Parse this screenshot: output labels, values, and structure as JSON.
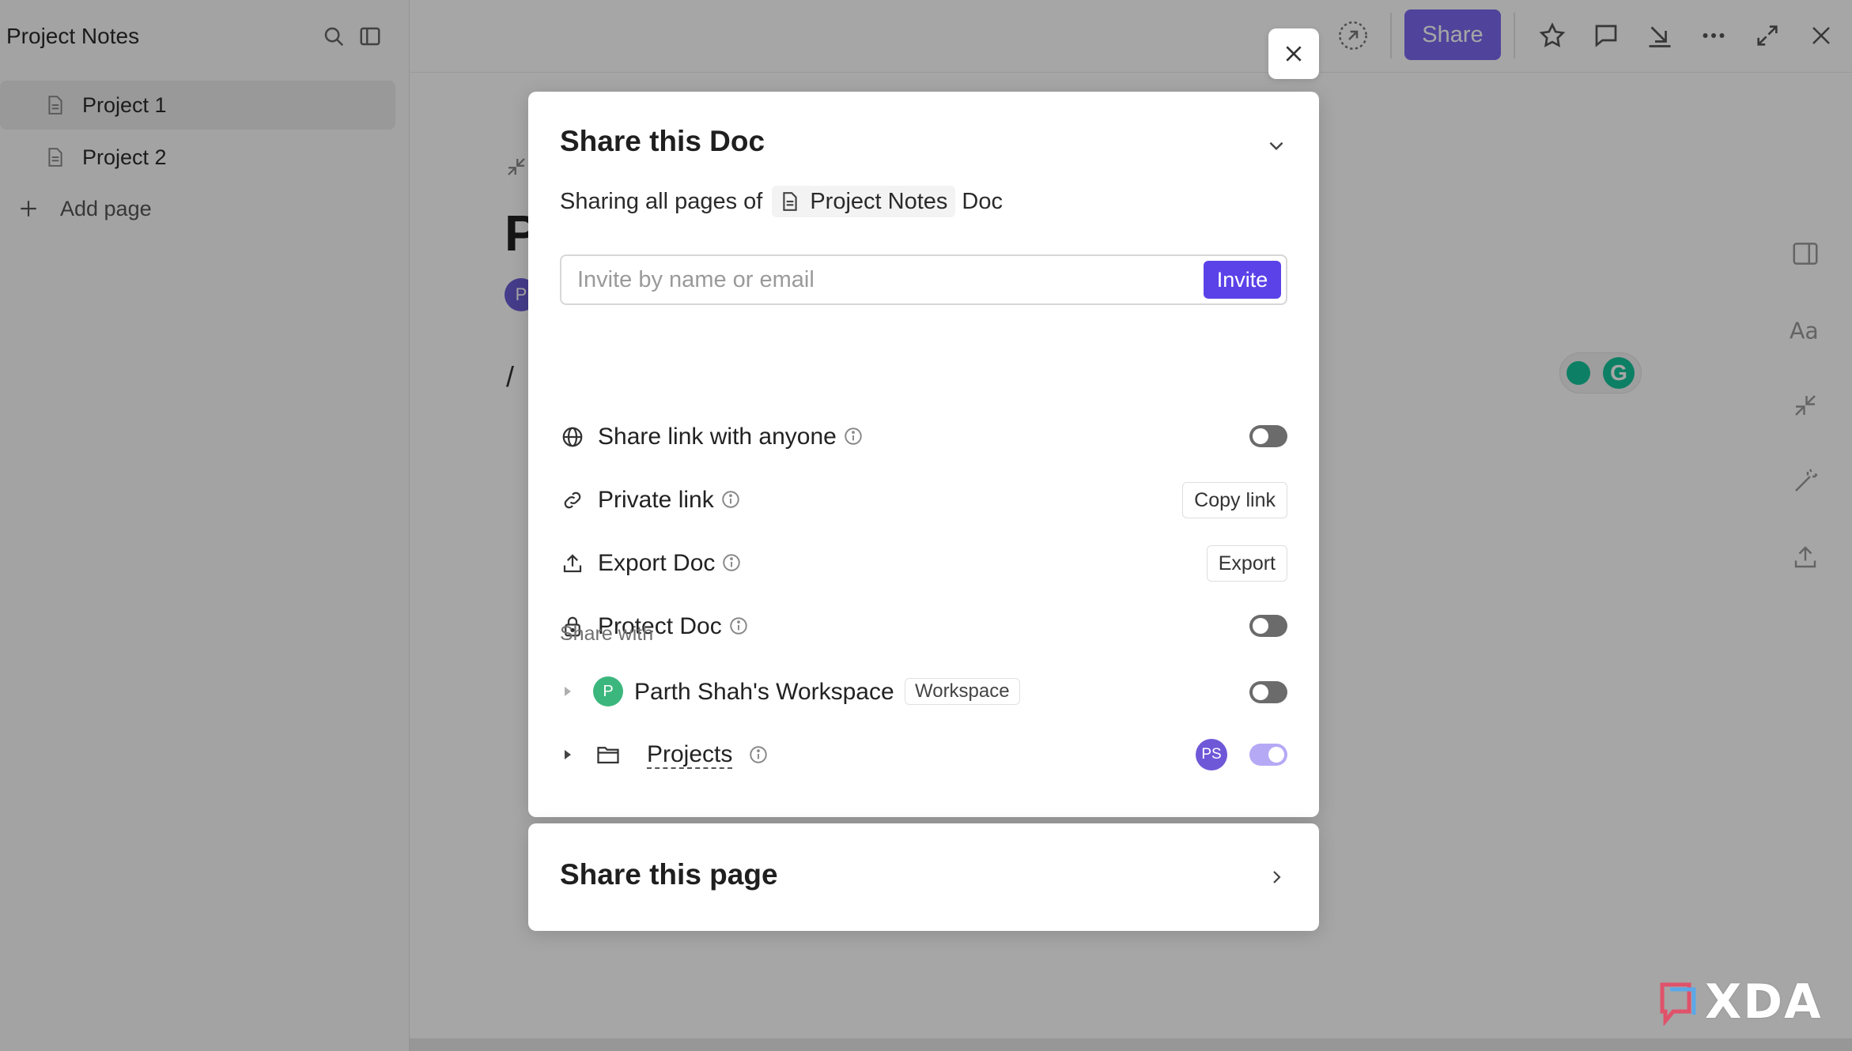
{
  "sidebar": {
    "title": "Project Notes",
    "items": [
      {
        "label": "Project 1"
      },
      {
        "label": "Project 2"
      }
    ],
    "add_page_label": "Add page"
  },
  "topbar": {
    "share_label": "Share"
  },
  "document": {
    "title_initial": "P",
    "avatar_initial": "P",
    "slash": "/"
  },
  "share_doc": {
    "title": "Share this Doc",
    "sharing_prefix": "Sharing all pages of",
    "doc_name": "Project Notes",
    "sharing_suffix": "Doc",
    "invite_placeholder": "Invite by name or email",
    "invite_button": "Invite",
    "options": {
      "share_link": {
        "label": "Share link with anyone",
        "enabled": false
      },
      "private_link": {
        "label": "Private link",
        "button": "Copy link"
      },
      "export_doc": {
        "label": "Export Doc",
        "button": "Export"
      },
      "protect_doc": {
        "label": "Protect Doc",
        "enabled": false
      }
    },
    "share_with_label": "Share with",
    "share_with": [
      {
        "name": "Parth Shah's Workspace",
        "avatar": "P",
        "badge": "Workspace",
        "enabled": false
      },
      {
        "name": "Projects",
        "avatar": "PS",
        "enabled": true
      }
    ]
  },
  "share_page": {
    "title": "Share this page"
  },
  "watermark": "XDA",
  "colors": {
    "accent": "#7b68ee",
    "invite": "#5b42e8",
    "workspace_avatar": "#3bb77e",
    "grammarly": "#15c39a"
  }
}
